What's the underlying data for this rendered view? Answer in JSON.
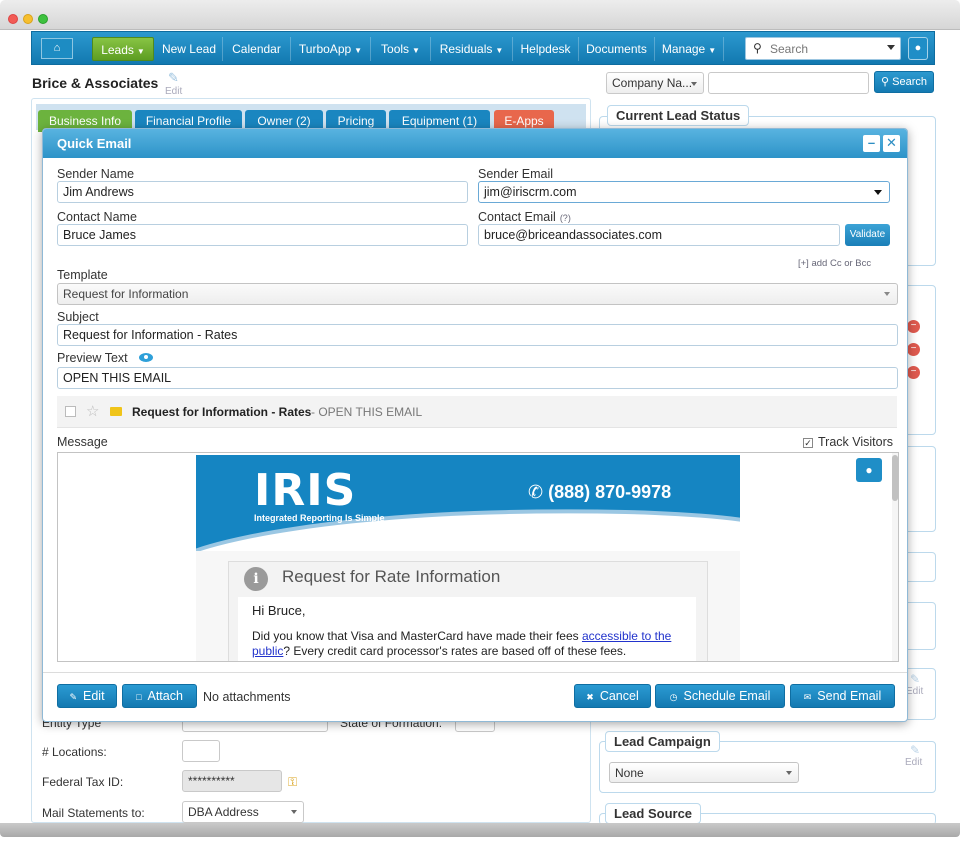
{
  "nav": {
    "home_icon": "home-icon",
    "items": [
      {
        "label": "Leads",
        "caret": true
      },
      {
        "label": "New Lead",
        "caret": false
      },
      {
        "label": "Calendar",
        "caret": false
      },
      {
        "label": "TurboApp",
        "caret": true
      },
      {
        "label": "Tools",
        "caret": true
      },
      {
        "label": "Residuals",
        "caret": true
      },
      {
        "label": "Helpdesk",
        "caret": false
      },
      {
        "label": "Documents",
        "caret": false
      },
      {
        "label": "Manage",
        "caret": true
      }
    ],
    "search_placeholder": "Search"
  },
  "page": {
    "title": "Brice & Associates",
    "edit_label": "Edit",
    "company_select": "Company Na...",
    "search_button": "Search"
  },
  "bg_tabs": [
    "Business Info",
    "Financial Profile",
    "Owner (2)",
    "Pricing",
    "Equipment (1)",
    "E-Apps"
  ],
  "right_panel": {
    "lead_status_title": "Current Lead Status",
    "lead_campaign_title": "Lead Campaign",
    "lead_campaign_value": "None",
    "lead_source_title": "Lead Source",
    "edit_label": "Edit"
  },
  "bg_form": {
    "entity_type_label": "Entity Type",
    "state_formation_label": "State of Formation:",
    "locations_label": "# Locations:",
    "federal_tax_label": "Federal Tax ID:",
    "federal_tax_value": "**********",
    "mail_statements_label": "Mail Statements to:",
    "mail_statements_value": "DBA Address"
  },
  "modal": {
    "title": "Quick Email",
    "sender_name_label": "Sender Name",
    "sender_name_value": "Jim Andrews",
    "sender_email_label": "Sender Email",
    "sender_email_value": "jim@iriscrm.com",
    "contact_name_label": "Contact Name",
    "contact_name_value": "Bruce James",
    "contact_email_label": "Contact Email",
    "contact_email_help": "(?)",
    "contact_email_value": "bruce@briceandassociates.com",
    "validate_label": "Validate",
    "add_cc_label": "[+] add Cc or Bcc",
    "template_label": "Template",
    "template_value": "Request for Information",
    "subject_label": "Subject",
    "subject_value": "Request for Information - Rates",
    "preview_text_label": "Preview Text",
    "preview_text_value": "OPEN THIS EMAIL",
    "inbox_preview_subject": "Request for Information - Rates",
    "inbox_preview_text": "- OPEN THIS EMAIL",
    "message_label": "Message",
    "track_visitors_label": "Track Visitors",
    "track_visitors_checked": true,
    "email": {
      "logo": "IRIS",
      "tagline": "Integrated Reporting Is Simple",
      "phone": "(888) 870-9978",
      "card_title": "Request for Rate Information",
      "greeting": "Hi Bruce,",
      "para_before": "Did you know that Visa and MasterCard have made their fees ",
      "para_link": "accessible to the public",
      "para_after": "? Every credit card processor's rates are based off of these fees."
    },
    "edit_button": "Edit",
    "attach_button": "Attach",
    "no_attachments": "No attachments",
    "cancel_button": "Cancel",
    "schedule_button": "Schedule Email",
    "send_button": "Send Email"
  }
}
